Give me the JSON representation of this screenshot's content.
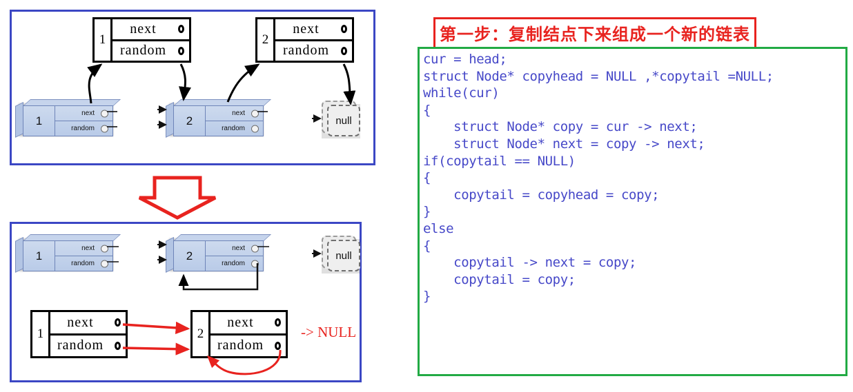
{
  "diagram": {
    "panel_border_color": "#3b47c4",
    "top_panel": {
      "flat_nodes": [
        {
          "id": "1",
          "next_label": "next",
          "random_label": "random"
        },
        {
          "id": "2",
          "next_label": "next",
          "random_label": "random"
        }
      ],
      "blue_nodes": [
        {
          "id": "1",
          "next_label": "next",
          "random_label": "random"
        },
        {
          "id": "2",
          "next_label": "next",
          "random_label": "random"
        }
      ],
      "null_node_label": "null"
    },
    "bottom_panel": {
      "blue_nodes": [
        {
          "id": "1",
          "next_label": "next",
          "random_label": "random"
        },
        {
          "id": "2",
          "next_label": "next",
          "random_label": "random"
        }
      ],
      "null_node_label": "null",
      "flat_nodes": [
        {
          "id": "1",
          "next_label": "next",
          "random_label": "random"
        },
        {
          "id": "2",
          "next_label": "next",
          "random_label": "random"
        }
      ],
      "null_pointer_text": "-> NULL",
      "arrow_color": "#e8231f"
    },
    "big_arrow_color": "#e8231f"
  },
  "step": {
    "title": "第一步：复制结点下来组成一个新的链表",
    "title_border_color": "#e8231f",
    "title_text_color": "#e8231f"
  },
  "code": {
    "border_color": "#22aa44",
    "text_color": "#4648c8",
    "body": "cur = head;\nstruct Node* copyhead = NULL ,*copytail =NULL;\nwhile(cur)\n{\n    struct Node* copy = cur -> next;\n    struct Node* next = copy -> next;\nif(copytail == NULL)\n{\n    copytail = copyhead = copy;\n}\nelse\n{\n    copytail -> next = copy;\n    copytail = copy;\n}"
  }
}
